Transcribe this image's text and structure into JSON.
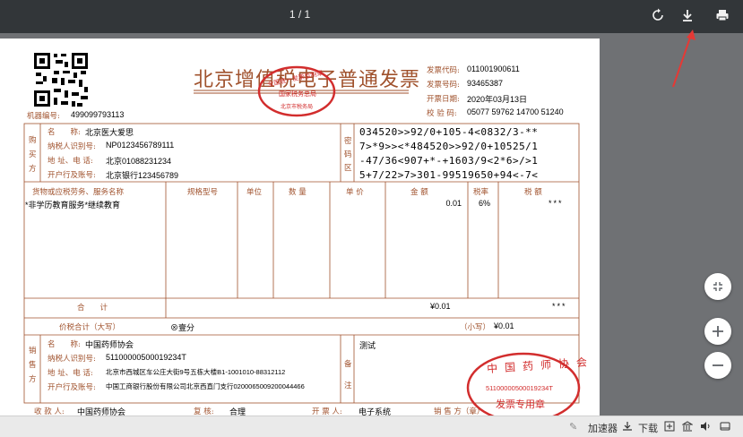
{
  "toolbar": {
    "page_indicator": "1 / 1"
  },
  "invoice": {
    "title": "北京增值税电子普通发票",
    "code_label": "发票代码:",
    "code": "011001900611",
    "number_label": "发票号码:",
    "number": "93465387",
    "date_label": "开票日期:",
    "date": "2020年03月13日",
    "check_label": "校 验 码:",
    "check": "05077 59762 14700 51240",
    "machine_label": "机器编号:",
    "machine": "499099793113",
    "buyer_side": [
      "购",
      "买",
      "方"
    ],
    "buyer": {
      "name_label": "名　　称:",
      "name": "北京医大爱思",
      "tax_label": "纳税人识别号:",
      "tax": "NP0123456789111",
      "addr_label": "地 址、电 话:",
      "addr": "北京01088231234",
      "bank_label": "开户行及账号:",
      "bank": "北京银行123456789"
    },
    "cipher_side": [
      "密",
      "码",
      "区"
    ],
    "cipher": [
      "034520>>92/0+105-4<0832/3-**",
      "7>*9>><*484520>>92/0+10525/1",
      "-47/36<907+*-+1603/9<2*6>/>1",
      "5+7/22>7>301-99519650+94<-7<"
    ],
    "headers": {
      "goods": "货物或应税劳务、服务名称",
      "spec": "规格型号",
      "unit": "单位",
      "qty": "数 量",
      "price": "单 价",
      "amount": "金 额",
      "rate": "税率",
      "tax": "税 额"
    },
    "item": {
      "name": "*非学历教育服务*继续教育",
      "amount": "0.01",
      "rate": "6%",
      "tax": "***"
    },
    "total_label": "合　　计",
    "total_amount": "¥0.01",
    "total_tax": "***",
    "sum_label": "价税合计（大写）",
    "sum_words": "⊗壹分",
    "sum_small_label": "（小写）",
    "sum_small": "¥0.01",
    "seller_side": [
      "销",
      "售",
      "方"
    ],
    "seller": {
      "name_label": "名　　称:",
      "name": "中国药师协会",
      "tax_label": "纳税人识别号:",
      "tax": "51100000500019234T",
      "addr_label": "地 址、电 话:",
      "addr": "北京市西城区车公庄大街9号五栋大楼B1-1001010-88312112",
      "bank_label": "开户行及账号:",
      "bank": "中国工商银行股份有限公司北京西直门支行0200065009200044466"
    },
    "remark_side": [
      "备",
      "注"
    ],
    "remark": "测试",
    "footer": {
      "payee_label": "收 款 人:",
      "payee": "中国药师协会",
      "review_label": "复 核:",
      "review": "合理",
      "drawer_label": "开 票 人:",
      "drawer": "电子系统",
      "seller_label": "销 售 方（章）"
    },
    "tax_seal": {
      "top": "全国统一发票监制章",
      "mid": "国家税务总局",
      "bottom": "北京市税务局"
    },
    "seller_seal": {
      "org": "中国药师协会",
      "id": "51100000500019234T",
      "bottom": "发票专用章"
    }
  },
  "status": {
    "accelerator": "加速器",
    "download": "下载"
  },
  "colors": {
    "invoice_line": "#a0522d",
    "seal_red": "#d22d2d",
    "arrow_red": "#e53935"
  },
  "icons": [
    "rotate-icon",
    "download-icon",
    "print-icon",
    "fit-page-icon",
    "zoom-in-icon",
    "zoom-out-icon"
  ]
}
